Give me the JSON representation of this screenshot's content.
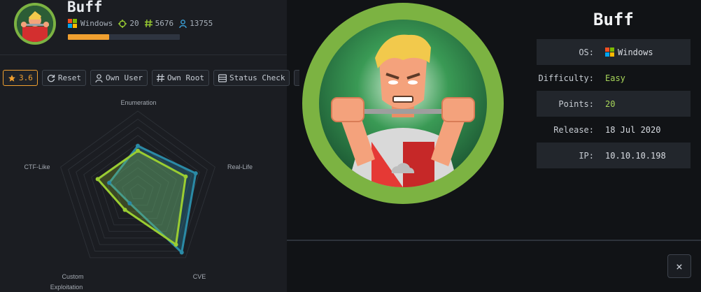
{
  "machine": {
    "name": "Buff",
    "os": "Windows",
    "points": "20",
    "user_owns": "5676",
    "root_owns": "13755",
    "progress_fraction": 0.37
  },
  "toolbar": {
    "rating": "3.6",
    "reset": "Reset",
    "own_user": "Own User",
    "own_root": "Own Root",
    "status_check": "Status Check"
  },
  "radar": {
    "axes": [
      "Enumeration",
      "Real-Life",
      "CVE",
      "Custom",
      "Exploitation",
      "CTF-Like"
    ],
    "series_colors": [
      "#2a8aa6",
      "#9acd32"
    ]
  },
  "info": {
    "title": "Buff",
    "rows": [
      {
        "k": "OS:",
        "v": "Windows"
      },
      {
        "k": "Difficulty:",
        "v": "Easy"
      },
      {
        "k": "Points:",
        "v": "20"
      },
      {
        "k": "Release:",
        "v": "18 Jul 2020"
      },
      {
        "k": "IP:",
        "v": "10.10.10.198"
      }
    ]
  },
  "close": "×"
}
